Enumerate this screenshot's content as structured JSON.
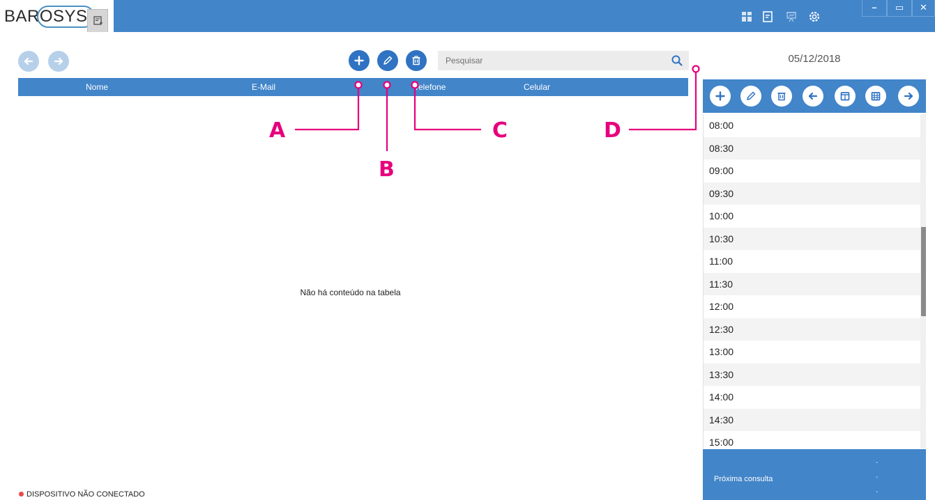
{
  "app": {
    "logo_text_a": "BAR",
    "logo_text_b": "SYS",
    "logo_ring_letter": "O"
  },
  "title_icons": [
    "dashboard-icon",
    "notes-icon",
    "presentation-icon",
    "settings-icon"
  ],
  "window_controls": {
    "minimize": "–",
    "restore": "▭",
    "close": "✕"
  },
  "search": {
    "placeholder": "Pesquisar"
  },
  "table": {
    "columns": [
      "Nome",
      "E-Mail",
      "Telefone",
      "Celular"
    ],
    "empty_message": "Não há conteúdo na tabela"
  },
  "status": {
    "text": "DISPOSITIVO NÃO CONECTADO",
    "color": "#e94a4a"
  },
  "schedule": {
    "date": "05/12/2018",
    "slots": [
      "08:00",
      "08:30",
      "09:00",
      "09:30",
      "10:00",
      "10:30",
      "11:00",
      "11:30",
      "12:00",
      "12:30",
      "13:00",
      "13:30",
      "14:00",
      "14:30",
      "15:00"
    ],
    "next_label": "Próxima consulta",
    "next_values": [
      "-",
      "-",
      "-"
    ]
  },
  "callouts": {
    "a": "A",
    "b": "B",
    "c": "C",
    "d": "D"
  },
  "colors": {
    "accent": "#4285c9",
    "button": "#2f73c2",
    "callout": "#e6007e"
  }
}
